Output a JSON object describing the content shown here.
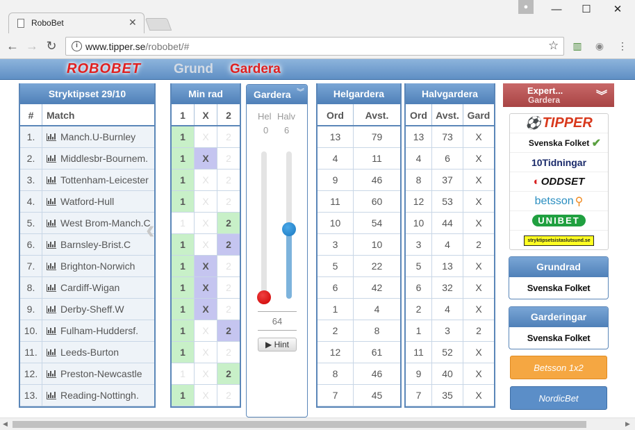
{
  "browser": {
    "tab_title": "RoboBet",
    "url_host": "www.tipper.se",
    "url_path": "/robobet/#"
  },
  "header": {
    "logo": "ROBOBET",
    "nav": [
      "Grund",
      "Gardera"
    ]
  },
  "match_panel": {
    "title": "Stryktipset 29/10",
    "col_num": "#",
    "col_match": "Match",
    "rows": [
      {
        "n": "1.",
        "match": "Manch.U-Burnley"
      },
      {
        "n": "2.",
        "match": "Middlesbr-Bournem."
      },
      {
        "n": "3.",
        "match": "Tottenham-Leicester"
      },
      {
        "n": "4.",
        "match": "Watford-Hull"
      },
      {
        "n": "5.",
        "match": "West Brom-Manch.C"
      },
      {
        "n": "6.",
        "match": "Barnsley-Brist.C"
      },
      {
        "n": "7.",
        "match": "Brighton-Norwich"
      },
      {
        "n": "8.",
        "match": "Cardiff-Wigan"
      },
      {
        "n": "9.",
        "match": "Derby-Sheff.W"
      },
      {
        "n": "10.",
        "match": "Fulham-Huddersf."
      },
      {
        "n": "11.",
        "match": "Leeds-Burton"
      },
      {
        "n": "12.",
        "match": "Preston-Newcastle"
      },
      {
        "n": "13.",
        "match": "Reading-Nottingh."
      }
    ]
  },
  "minrad": {
    "title": "Min rad",
    "cols": [
      "1",
      "X",
      "2"
    ],
    "rows": [
      [
        "on1",
        "off",
        "off"
      ],
      [
        "on1",
        "onx",
        "off"
      ],
      [
        "on1",
        "off",
        "off"
      ],
      [
        "on1",
        "off",
        "off"
      ],
      [
        "off",
        "off",
        "on2"
      ],
      [
        "on1",
        "off",
        "on2p"
      ],
      [
        "on1",
        "onx",
        "off"
      ],
      [
        "on1",
        "onx",
        "off"
      ],
      [
        "on1",
        "onx",
        "off"
      ],
      [
        "on1",
        "off",
        "on2p"
      ],
      [
        "on1",
        "off",
        "off"
      ],
      [
        "off",
        "off",
        "on2"
      ],
      [
        "on1",
        "off",
        "off"
      ]
    ]
  },
  "gardera": {
    "title": "Gardera",
    "hel_label": "Hel",
    "halv_label": "Halv",
    "hel_value": "0",
    "halv_value": "6",
    "total": "64",
    "hint_label": "Hint",
    "hel_level": 0.0,
    "halv_level": 0.46
  },
  "helgardera": {
    "title": "Helgardera",
    "cols": [
      "Ord",
      "Avst."
    ],
    "rows": [
      [
        "13",
        "79"
      ],
      [
        "4",
        "11"
      ],
      [
        "9",
        "46"
      ],
      [
        "11",
        "60"
      ],
      [
        "10",
        "54"
      ],
      [
        "3",
        "10"
      ],
      [
        "5",
        "22"
      ],
      [
        "6",
        "42"
      ],
      [
        "1",
        "4"
      ],
      [
        "2",
        "8"
      ],
      [
        "12",
        "61"
      ],
      [
        "8",
        "46"
      ],
      [
        "7",
        "45"
      ]
    ]
  },
  "halvgardera": {
    "title": "Halvgardera",
    "cols": [
      "Ord",
      "Avst.",
      "Gard"
    ],
    "rows": [
      [
        "13",
        "73",
        "X"
      ],
      [
        "4",
        "6",
        "X"
      ],
      [
        "8",
        "37",
        "X"
      ],
      [
        "12",
        "53",
        "X"
      ],
      [
        "10",
        "44",
        "X"
      ],
      [
        "3",
        "4",
        "2"
      ],
      [
        "5",
        "13",
        "X"
      ],
      [
        "6",
        "32",
        "X"
      ],
      [
        "2",
        "4",
        "X"
      ],
      [
        "1",
        "3",
        "2"
      ],
      [
        "11",
        "52",
        "X"
      ],
      [
        "9",
        "40",
        "X"
      ],
      [
        "7",
        "35",
        "X"
      ]
    ]
  },
  "expert": {
    "line1": "Expert...",
    "line2": "Gardera",
    "sources": [
      "TIPPER",
      "Svenska Folket",
      "10Tidningar",
      "ODDSET",
      "betsson",
      "UNIBET",
      "stryktipsetsistaslutsund.se"
    ]
  },
  "grundrad": {
    "title": "Grundrad",
    "logo": "Svenska Folket"
  },
  "garderingar": {
    "title": "Garderingar",
    "logo": "Svenska Folket"
  },
  "buttons": {
    "betsson": "Betsson 1x2",
    "nordicbet": "NordicBet"
  },
  "colors": {
    "accent_blue": "#5a86b8",
    "green_cell": "#c8f0c8",
    "purple_cell": "#c5c5f0",
    "red": "#e02020",
    "betsson_orange": "#f5a742",
    "nordicbet_blue": "#5b8ec8"
  }
}
